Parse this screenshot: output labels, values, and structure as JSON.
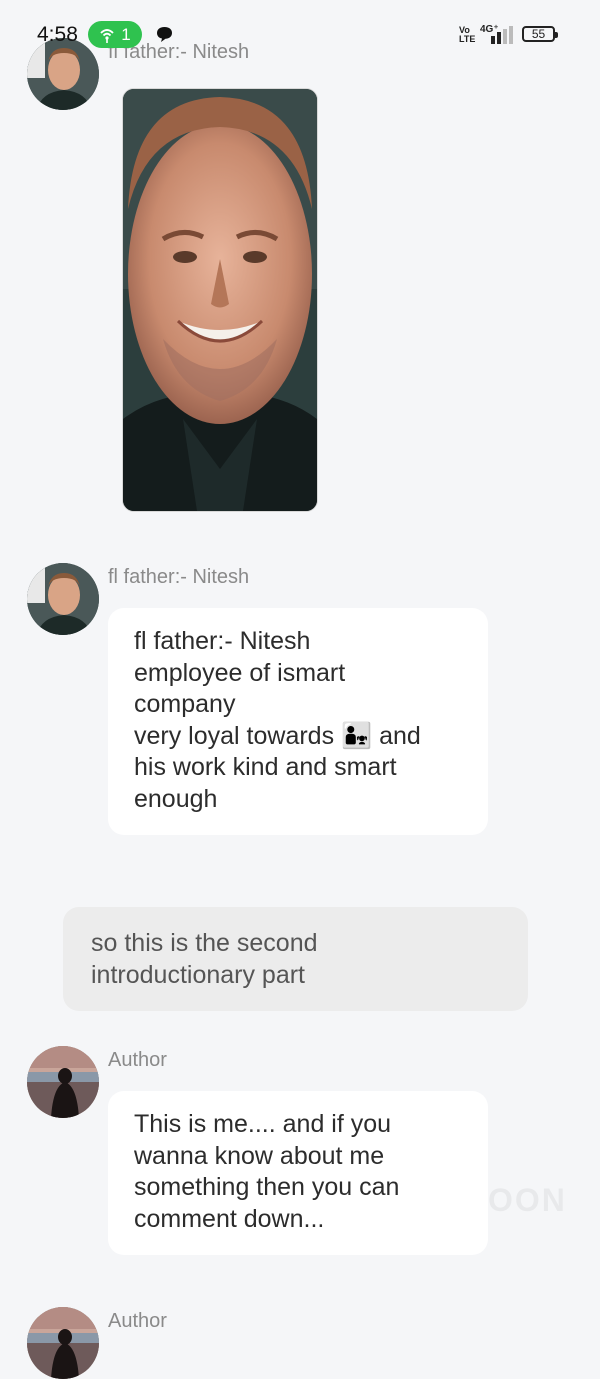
{
  "status_bar": {
    "time": "4:58",
    "hotspot_count": "1",
    "volte": "Vo LTE",
    "network": "4G⁺",
    "battery": "55"
  },
  "messages": [
    {
      "type": "image",
      "sender": "fl father:- Nitesh",
      "avatar_icon": "avatar-man-icon"
    },
    {
      "type": "text",
      "sender": "fl father:- Nitesh",
      "lines": [
        "fl father:- Nitesh",
        "employee of ismart",
        "company",
        "very loyal towards",
        "and",
        "his work kind and smart",
        "enough"
      ],
      "emoji": "👨‍👧"
    },
    {
      "type": "narration",
      "lines": [
        "so this is the second",
        "introductionary part"
      ]
    },
    {
      "type": "text",
      "sender": "Author",
      "lines": [
        "This is me.... and if you",
        "wanna  know about me",
        "something then you can",
        "comment down..."
      ]
    },
    {
      "type": "partial",
      "sender": "Author"
    }
  ],
  "watermark": "OON"
}
